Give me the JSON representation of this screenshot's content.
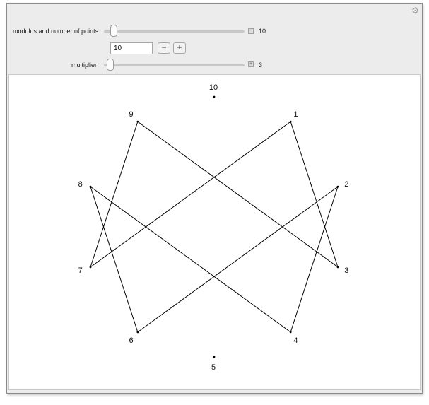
{
  "controls": {
    "modulus": {
      "label": "modulus and number of points",
      "value": "10",
      "input_value": "10",
      "minus_label": "−",
      "plus_label": "+",
      "slider_fraction": 0.05
    },
    "multiplier": {
      "label": "multiplier",
      "value": "3",
      "slider_fraction": 0.02
    }
  },
  "plot": {
    "modulus": 10,
    "multiplier": 3,
    "points": [
      {
        "label": "10",
        "index": 0
      },
      {
        "label": "1",
        "index": 1
      },
      {
        "label": "2",
        "index": 2
      },
      {
        "label": "3",
        "index": 3
      },
      {
        "label": "4",
        "index": 4
      },
      {
        "label": "5",
        "index": 5
      },
      {
        "label": "6",
        "index": 6
      },
      {
        "label": "7",
        "index": 7
      },
      {
        "label": "8",
        "index": 8
      },
      {
        "label": "9",
        "index": 9
      }
    ],
    "chords": [
      {
        "from": 1,
        "to": 3
      },
      {
        "from": 2,
        "to": 6
      },
      {
        "from": 3,
        "to": 9
      },
      {
        "from": 4,
        "to": 2
      },
      {
        "from": 6,
        "to": 8
      },
      {
        "from": 7,
        "to": 1
      },
      {
        "from": 8,
        "to": 4
      },
      {
        "from": 9,
        "to": 7
      }
    ]
  },
  "icons": {
    "options": "gear-icon",
    "modulus_expand": "expand-icon",
    "multiplier_expand": "expand-icon"
  }
}
